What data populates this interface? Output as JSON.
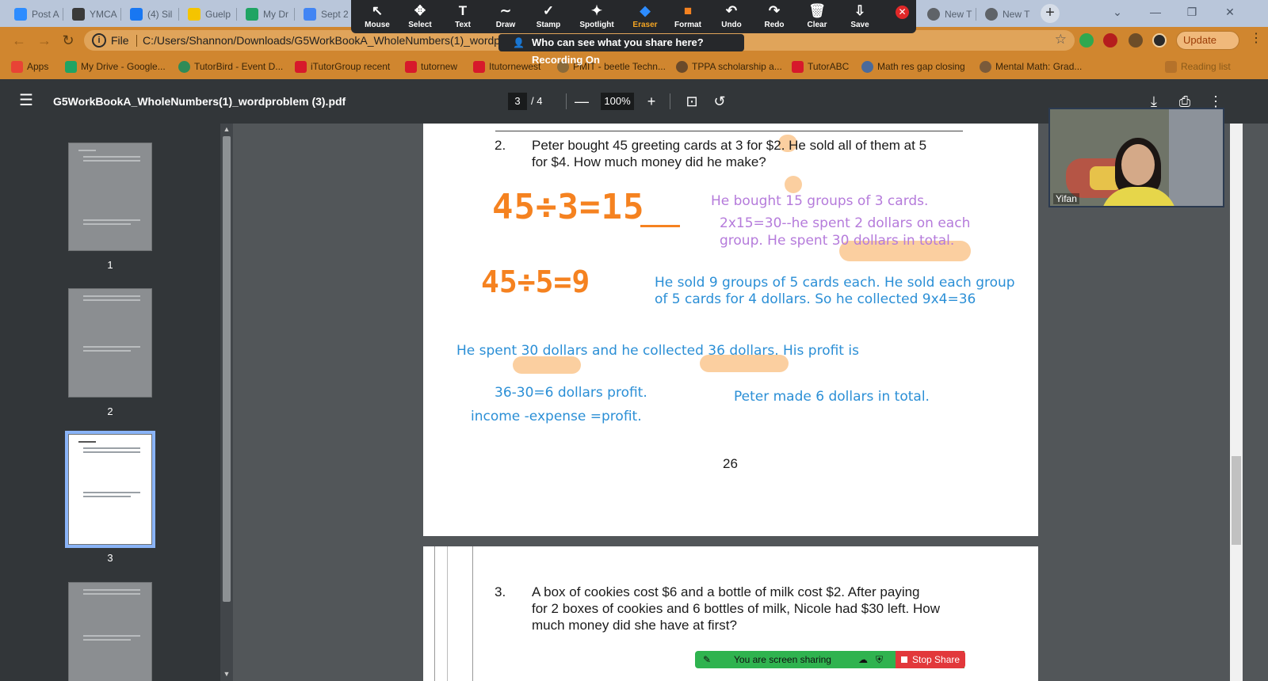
{
  "tabs": [
    {
      "label": "Post A",
      "fav_color": "#2d8cff"
    },
    {
      "label": "YMCA",
      "fav_color": "#3a3a3a"
    },
    {
      "label": "(4) Sil",
      "fav_color": "#1877f2"
    },
    {
      "label": "Guelp",
      "fav_color": "#f5c400"
    },
    {
      "label": "My Dr",
      "fav_color": "#1fa463"
    },
    {
      "label": "Sept 2",
      "fav_color": "#4285f4"
    },
    {
      "label": "New T",
      "fav_color": "#5f6368"
    },
    {
      "label": "New T",
      "fav_color": "#5f6368"
    }
  ],
  "zoom_toolbar": {
    "tools": [
      {
        "label": "Mouse",
        "icon": "↖"
      },
      {
        "label": "Select",
        "icon": "✥"
      },
      {
        "label": "Text",
        "icon": "T"
      },
      {
        "label": "Draw",
        "icon": "∼"
      },
      {
        "label": "Stamp",
        "icon": "✓"
      },
      {
        "label": "Spotlight",
        "icon": "✦"
      },
      {
        "label": "Eraser",
        "icon": "◆"
      },
      {
        "label": "Format",
        "icon": "■"
      },
      {
        "label": "Undo",
        "icon": "↶"
      },
      {
        "label": "Redo",
        "icon": "↷"
      },
      {
        "label": "Clear",
        "icon": "🗑"
      },
      {
        "label": "Save",
        "icon": "⇩"
      }
    ],
    "banner": "Who can see what you share here? Recording On"
  },
  "address": {
    "scheme_label": "File",
    "url": "C:/Users/Shannon/Downloads/G5WorkBookA_WholeNumbers(1)_wordprob"
  },
  "update_label": "Update",
  "bookmarks": [
    {
      "label": "Apps",
      "fav_color": "#e84335"
    },
    {
      "label": "My Drive - Google...",
      "fav_color": "#1fa463"
    },
    {
      "label": "TutorBird - Event D...",
      "fav_color": "#2e8b57"
    },
    {
      "label": "iTutorGroup recent",
      "fav_color": "#d7192b"
    },
    {
      "label": "tutornew",
      "fav_color": "#d7192b"
    },
    {
      "label": "Itutornewest",
      "fav_color": "#d7192b"
    },
    {
      "label": "PMIT - beetle Techn...",
      "fav_color": "#8a6a3a"
    },
    {
      "label": "TPPA scholarship a...",
      "fav_color": "#6a4a2a"
    },
    {
      "label": "TutorABC",
      "fav_color": "#d7192b"
    },
    {
      "label": "Math res gap closing",
      "fav_color": "#4a6a9a"
    },
    {
      "label": "Mental Math: Grad...",
      "fav_color": "#7a5a3a"
    },
    {
      "label": "Reading list",
      "fav_color": "#b5722a"
    }
  ],
  "pdf": {
    "filename": "G5WorkBookA_WholeNumbers(1)_wordproblem (3).pdf",
    "current_page": "3",
    "total_pages": "/ 4",
    "zoom": "100%"
  },
  "thumbnails": [
    {
      "page": "1"
    },
    {
      "page": "2"
    },
    {
      "page": "3"
    }
  ],
  "page": {
    "q2_number": "2.",
    "q2_line1": "Peter bought 45 greeting cards at 3 for $2. He sold all of them at 5",
    "q2_line2": "for $4. How much money did he make?",
    "hand1": "45÷3=15",
    "hand2": "45÷5=9",
    "purple1": "He bought 15 groups of 3 cards.",
    "purple2": "2x15=30--he spent 2 dollars on each",
    "purple3": "group.  He spent 30 dollars in total.",
    "blue1": "He sold 9 groups of 5 cards each. He sold each group",
    "blue2": "of 5 cards for 4 dollars.  So he collected  9x4=36",
    "blue3": "He spent 30 dollars and he collected 36 dollars.  His profit is",
    "blue4": "36-30=6 dollars profit.",
    "blue5": "income -expense =profit.",
    "blue6": "Peter made 6 dollars in total.",
    "page_number": "26",
    "q3_number": "3.",
    "q3_line1": "A box of cookies cost $6 and a bottle of milk cost $2. After paying",
    "q3_line2": "for 2 boxes of cookies and 6 bottles of milk, Nicole had $30 left. How",
    "q3_line3": "much money did she have at first?"
  },
  "camera": {
    "name": "Yifan"
  },
  "share": {
    "status": "You are screen sharing",
    "stop_label": "Stop Share"
  }
}
